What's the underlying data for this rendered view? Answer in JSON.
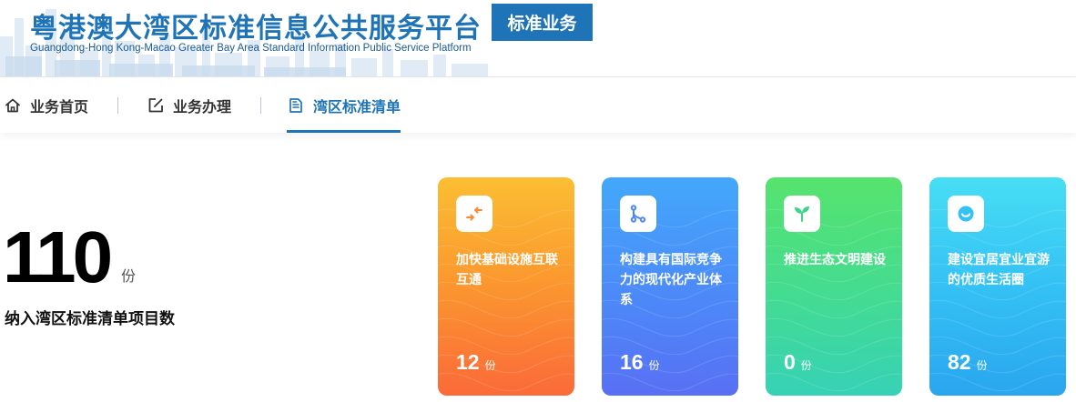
{
  "header": {
    "title": "粤港澳大湾区标准信息公共服务平台",
    "subtitle": "Guangdong-Hong Kong-Macao Greater Bay Area Standard Information Public Service Platform",
    "badge": "标准业务"
  },
  "nav": {
    "items": [
      {
        "label": "业务首页",
        "icon": "home-icon"
      },
      {
        "label": "业务办理",
        "icon": "edit-icon"
      },
      {
        "label": "湾区标准清单",
        "icon": "document-icon",
        "active": true
      }
    ],
    "separator": "|"
  },
  "stat": {
    "value": "110",
    "unit": "份",
    "label": "纳入湾区标准清单项目数"
  },
  "cards": [
    {
      "title": "加快基础设施互联互通",
      "count": "12",
      "unit": "份",
      "icon": "exchange-arrows-icon",
      "color": "#fb9a2e"
    },
    {
      "title": "构建具有国际竞争力的现代化产业体系",
      "count": "16",
      "unit": "份",
      "icon": "branch-icon",
      "color": "#4c89f8"
    },
    {
      "title": "推进生态文明建设",
      "count": "0",
      "unit": "份",
      "icon": "sprout-icon",
      "color": "#45dc8f"
    },
    {
      "title": "建设宜居宜业宜游的优质生活圈",
      "count": "82",
      "unit": "份",
      "icon": "smile-icon",
      "color": "#34c1f4"
    }
  ]
}
